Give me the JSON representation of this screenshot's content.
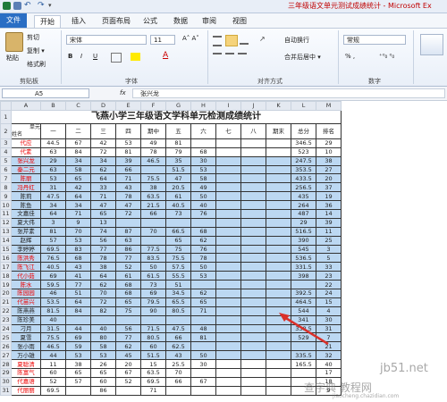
{
  "window": {
    "title": "三年级语文单元测试成绩统计 - Microsoft Ex"
  },
  "tabs": [
    {
      "label": "文件"
    },
    {
      "label": "开始"
    },
    {
      "label": "插入"
    },
    {
      "label": "页面布局"
    },
    {
      "label": "公式"
    },
    {
      "label": "数据"
    },
    {
      "label": "审阅"
    },
    {
      "label": "视图"
    }
  ],
  "ribbon": {
    "paste": "粘贴",
    "cut": "剪切",
    "copy": "复制 ▾",
    "format_painter": "格式刷",
    "clipboard_group": "剪贴板",
    "font_name": "宋体",
    "font_size": "11",
    "bold": "B",
    "italic": "I",
    "underline": "U",
    "font_group": "字体",
    "wrap_text": "自动换行",
    "merge_center": "合并后居中 ▾",
    "align_group": "对齐方式",
    "number_format": "常规",
    "number_group": "数字",
    "currency": "% ,",
    "decimals": "⁺⁰₀ ⁰₀"
  },
  "formula_bar": {
    "name_box": "A5",
    "fx": "fx",
    "content": "张兴龙"
  },
  "sheet": {
    "columns": [
      "A",
      "B",
      "C",
      "D",
      "E",
      "F",
      "G",
      "H",
      "I",
      "J",
      "K",
      "L",
      "M"
    ],
    "title": "飞燕小学三年级语文学科单元检测成绩统计",
    "header_unit": "单元",
    "header_name": "姓名",
    "headers": [
      "一",
      "二",
      "三",
      "四",
      "期中",
      "五",
      "六",
      "七",
      "八",
      "期末",
      "总分",
      "排名"
    ],
    "rows": [
      {
        "n": "3",
        "name": "代应",
        "red": true,
        "v": [
          "44.5",
          "67",
          "42",
          "53",
          "49",
          "81",
          "",
          "",
          "",
          "",
          "346.5",
          "29"
        ]
      },
      {
        "n": "4",
        "name": "代素",
        "red": true,
        "v": [
          "63",
          "84",
          "72",
          "81",
          "78",
          "79",
          "68",
          "",
          "",
          "",
          "523",
          "10"
        ]
      },
      {
        "n": "5",
        "name": "张兴龙",
        "red": true,
        "v": [
          "29",
          "34",
          "34",
          "39",
          "46.5",
          "35",
          "30",
          "",
          "",
          "",
          "247.5",
          "38"
        ]
      },
      {
        "n": "6",
        "name": "秦二元",
        "red": true,
        "v": [
          "63",
          "58",
          "62",
          "66",
          "",
          "51.5",
          "53",
          "",
          "",
          "",
          "353.5",
          "27"
        ]
      },
      {
        "n": "7",
        "name": "陈丽",
        "red": true,
        "v": [
          "53",
          "65",
          "64",
          "71",
          "75.5",
          "47",
          "58",
          "",
          "",
          "",
          "433.5",
          "20"
        ]
      },
      {
        "n": "8",
        "name": "冯丹红",
        "red": true,
        "v": [
          "31",
          "42",
          "33",
          "43",
          "38",
          "20.5",
          "49",
          "",
          "",
          "",
          "256.5",
          "37"
        ]
      },
      {
        "n": "9",
        "name": "陈莉",
        "red": false,
        "v": [
          "47.5",
          "64",
          "71",
          "78",
          "63.5",
          "61",
          "50",
          "",
          "",
          "",
          "435",
          "19"
        ]
      },
      {
        "n": "10",
        "name": "陈鱼",
        "red": false,
        "v": [
          "34",
          "34",
          "47",
          "47",
          "21.5",
          "40.5",
          "40",
          "",
          "",
          "",
          "264",
          "36"
        ]
      },
      {
        "n": "11",
        "name": "文嘉佳",
        "red": false,
        "v": [
          "64",
          "71",
          "65",
          "72",
          "66",
          "73",
          "76",
          "",
          "",
          "",
          "487",
          "14"
        ]
      },
      {
        "n": "12",
        "name": "夏大伟",
        "red": false,
        "v": [
          "3",
          "9",
          "13",
          "",
          "",
          "",
          "",
          "",
          "",
          "",
          "29",
          "39"
        ]
      },
      {
        "n": "13",
        "name": "张芹素",
        "red": false,
        "v": [
          "81",
          "70",
          "74",
          "87",
          "70",
          "66.5",
          "68",
          "",
          "",
          "",
          "516.5",
          "11"
        ]
      },
      {
        "n": "14",
        "name": "赵辉",
        "red": false,
        "v": [
          "57",
          "53",
          "56",
          "63",
          "",
          "65",
          "62",
          "",
          "",
          "",
          "390",
          "25"
        ]
      },
      {
        "n": "15",
        "name": "李婷婷",
        "red": false,
        "v": [
          "69.5",
          "83",
          "77",
          "86",
          "77.5",
          "75",
          "76",
          "",
          "",
          "",
          "545",
          "3"
        ]
      },
      {
        "n": "16",
        "name": "陈洪秀",
        "red": true,
        "v": [
          "76.5",
          "68",
          "78",
          "77",
          "83.5",
          "75.5",
          "78",
          "",
          "",
          "",
          "536.5",
          "5"
        ]
      },
      {
        "n": "17",
        "name": "陈飞江",
        "red": true,
        "v": [
          "40.5",
          "43",
          "38",
          "52",
          "50",
          "57.5",
          "50",
          "",
          "",
          "",
          "331.5",
          "33"
        ]
      },
      {
        "n": "18",
        "name": "代小茹",
        "red": true,
        "v": [
          "69",
          "41",
          "64",
          "61",
          "61.5",
          "55.5",
          "53",
          "",
          "",
          "",
          "398",
          "23"
        ]
      },
      {
        "n": "19",
        "name": "陈水",
        "red": true,
        "v": [
          "59.5",
          "77",
          "62",
          "68",
          "73",
          "51",
          "",
          "",
          "",
          "",
          "",
          "22"
        ]
      },
      {
        "n": "20",
        "name": "陈园园",
        "red": true,
        "v": [
          "46",
          "51",
          "70",
          "68",
          "69",
          "34.5",
          "62",
          "",
          "",
          "",
          "392.5",
          "24"
        ]
      },
      {
        "n": "21",
        "name": "代苗兴",
        "red": true,
        "v": [
          "53.5",
          "64",
          "72",
          "65",
          "79.5",
          "65.5",
          "65",
          "",
          "",
          "",
          "464.5",
          "15"
        ]
      },
      {
        "n": "22",
        "name": "陈燕燕",
        "red": false,
        "v": [
          "81.5",
          "84",
          "82",
          "75",
          "90",
          "80.5",
          "71",
          "",
          "",
          "",
          "544",
          "4"
        ]
      },
      {
        "n": "23",
        "name": "陈珍美",
        "red": false,
        "v": [
          "40",
          "",
          "",
          "",
          "",
          "",
          "",
          "",
          "",
          "",
          "341",
          "30"
        ]
      },
      {
        "n": "24",
        "name": "刁月",
        "red": false,
        "v": [
          "31.5",
          "44",
          "40",
          "56",
          "71.5",
          "47.5",
          "48",
          "",
          "",
          "",
          "338.5",
          "31"
        ]
      },
      {
        "n": "25",
        "name": "夏雪",
        "red": false,
        "v": [
          "75.5",
          "69",
          "80",
          "77",
          "80.5",
          "66",
          "81",
          "",
          "",
          "",
          "529",
          "7"
        ]
      },
      {
        "n": "26",
        "name": "张小雨",
        "red": false,
        "v": [
          "46.5",
          "59",
          "58",
          "62",
          "60",
          "62.5",
          "",
          "",
          "",
          "",
          "",
          "21"
        ]
      },
      {
        "n": "27",
        "name": "万小雄",
        "red": false,
        "v": [
          "44",
          "53",
          "53",
          "45",
          "51.5",
          "43",
          "50",
          "",
          "",
          "",
          "335.5",
          "32"
        ]
      },
      {
        "n": "28",
        "name": "夏聪清",
        "red": true,
        "v": [
          "11",
          "38",
          "26",
          "20",
          "15",
          "25.5",
          "30",
          "",
          "",
          "",
          "165.5",
          "40"
        ]
      },
      {
        "n": "29",
        "name": "陈富气",
        "red": true,
        "v": [
          "60",
          "65",
          "65",
          "67",
          "63.5",
          "70",
          "",
          "",
          "",
          "",
          "",
          "17"
        ]
      },
      {
        "n": "30",
        "name": "代嘉语",
        "red": true,
        "v": [
          "52",
          "57",
          "60",
          "52",
          "69.5",
          "66",
          "67",
          "",
          "",
          "",
          "",
          "18"
        ]
      },
      {
        "n": "31",
        "name": "代丽丽",
        "red": true,
        "v": [
          "69.5",
          "",
          "86",
          "",
          "71",
          "",
          "",
          "",
          "",
          "",
          "",
          "9"
        ]
      }
    ]
  },
  "watermark": {
    "site": "jb51.net",
    "text": "查字典 教程网",
    "sub": "jiaocheng.chazidian.com"
  }
}
